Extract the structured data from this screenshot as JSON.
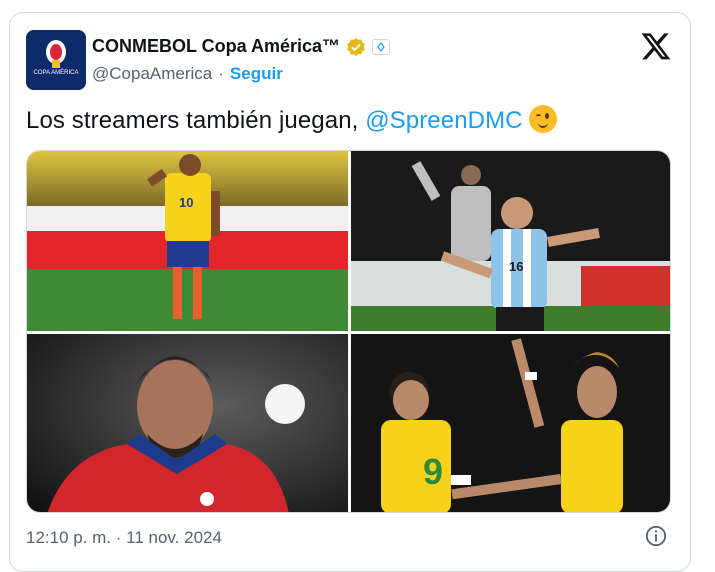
{
  "account": {
    "display_name": "CONMEBOL Copa América™",
    "handle": "@CopaAmerica",
    "separator": "·",
    "follow_label": "Seguir",
    "avatar_text": "COPA AMÉRICA"
  },
  "tweet": {
    "text": "Los streamers también juegan, ",
    "mention": "@SpreenDMC",
    "emoji": "winking-face"
  },
  "media": {
    "photos": [
      {
        "subject": "Colombia player in yellow #10",
        "number": "10"
      },
      {
        "subject": "Argentina player celebrating #16",
        "number": "16"
      },
      {
        "subject": "Chile player in red shirt",
        "number": ""
      },
      {
        "subject": "Brazil players in yellow #9",
        "number": "9"
      }
    ]
  },
  "meta": {
    "timestamp": "12:10 p. m. · 11 nov. 2024"
  },
  "colors": {
    "accent": "#1d9bf0",
    "secondary_text": "#536471",
    "border": "#cfd9de"
  }
}
